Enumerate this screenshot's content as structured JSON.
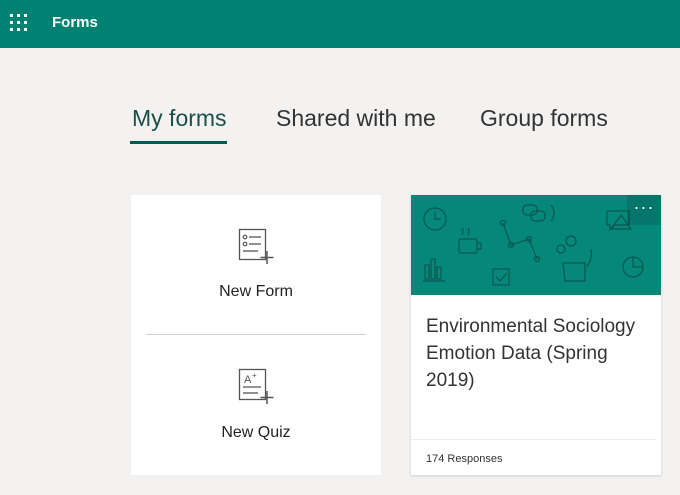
{
  "app": {
    "title": "Forms"
  },
  "tabs": [
    {
      "label": "My forms",
      "active": true
    },
    {
      "label": "Shared with me",
      "active": false
    },
    {
      "label": "Group forms",
      "active": false
    }
  ],
  "new_card": {
    "new_form_label": "New Form",
    "new_quiz_label": "New Quiz"
  },
  "forms": [
    {
      "title": "Environmental Sociology Emotion Data (Spring 2019)",
      "responses": "174 Responses",
      "more_label": "···",
      "banner_color": "#05877a"
    }
  ],
  "colors": {
    "topbar": "#008272",
    "tab_active_underline": "#005a51",
    "background": "#f3f2f1"
  },
  "icons": [
    "waffle-icon",
    "new-form-icon",
    "new-quiz-icon",
    "more-options-icon"
  ]
}
